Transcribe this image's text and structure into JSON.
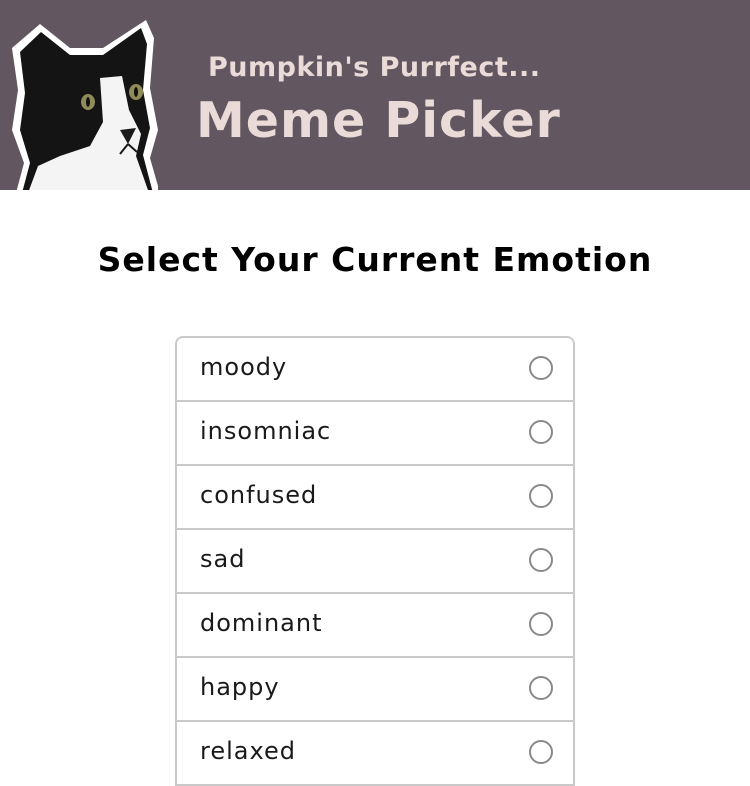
{
  "header": {
    "subtitle": "Pumpkin's Purrfect...",
    "title": "Meme Picker",
    "background_color": "#625660",
    "text_color": "#eadbd8",
    "image_icon": "cat-photo-icon"
  },
  "main": {
    "heading": "Select Your Current Emotion",
    "options": [
      {
        "label": "moody",
        "selected": false
      },
      {
        "label": "insomniac",
        "selected": false
      },
      {
        "label": "confused",
        "selected": false
      },
      {
        "label": "sad",
        "selected": false
      },
      {
        "label": "dominant",
        "selected": false
      },
      {
        "label": "happy",
        "selected": false
      },
      {
        "label": "relaxed",
        "selected": false
      }
    ]
  }
}
